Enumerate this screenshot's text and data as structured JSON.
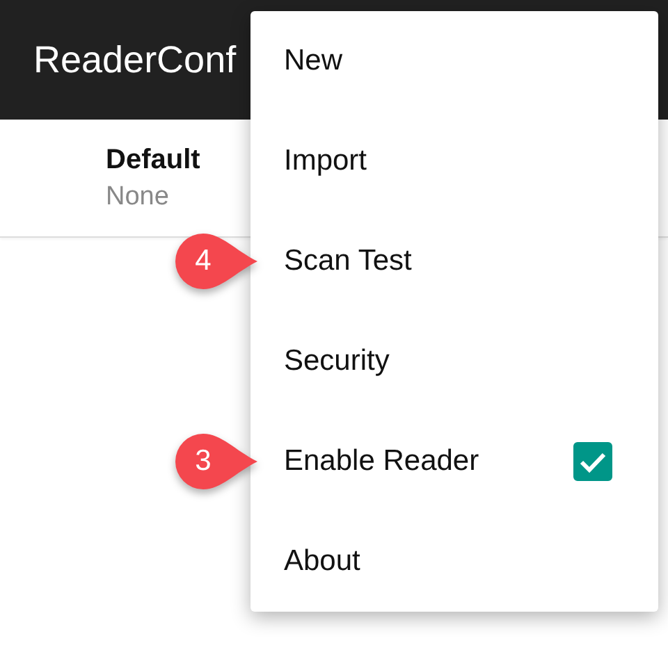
{
  "app_bar": {
    "title": "ReaderConf"
  },
  "list": [
    {
      "title": "Default",
      "subtitle": "None"
    }
  ],
  "menu": [
    {
      "kind": "item",
      "label": "New"
    },
    {
      "kind": "item",
      "label": "Import"
    },
    {
      "kind": "item",
      "label": "Scan Test",
      "callout": "4"
    },
    {
      "kind": "item",
      "label": "Security"
    },
    {
      "kind": "checkbox",
      "label": "Enable Reader",
      "checked": true,
      "callout": "3"
    },
    {
      "kind": "item",
      "label": "About"
    }
  ]
}
